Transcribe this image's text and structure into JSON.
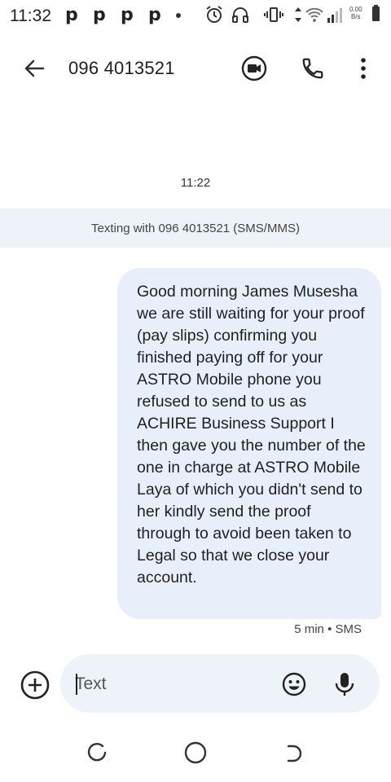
{
  "status_bar": {
    "time": "11:32",
    "notification_icons": [
      "p",
      "p",
      "p",
      "p"
    ],
    "net_speed_value": "0.00",
    "net_speed_unit": "B/s"
  },
  "app_bar": {
    "contact": "096 4013521",
    "back_icon": "arrow-left-icon",
    "video_icon": "video-call-icon",
    "phone_icon": "phone-icon",
    "more_icon": "more-vert-icon"
  },
  "conversation": {
    "timestamp": "11:22",
    "banner": "Texting with 096 4013521 (SMS/MMS)",
    "messages": [
      {
        "text": "Good morning James Musesha we are still waiting for your proof (pay slips) confirming you finished paying off for your ASTRO Mobile phone you refused to send to us as ACHIRE Business Support I then gave you the number of the one in charge at ASTRO Mobile Laya of which you didn't send to her kindly send the proof through to avoid been taken to Legal so that we close your account.",
        "meta": "5 min • SMS"
      }
    ]
  },
  "compose": {
    "placeholder": "Text",
    "attach_icon": "add-circle-icon",
    "emoji_icon": "emoji-icon",
    "mic_icon": "mic-icon"
  },
  "colors": {
    "bubble": "#e8effb",
    "banner": "#eef2f9",
    "text": "#1f1f1f"
  }
}
